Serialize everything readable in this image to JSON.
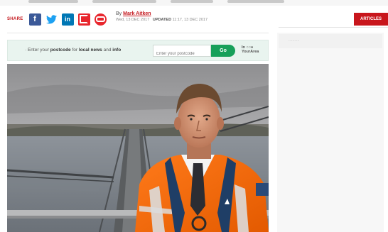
{
  "share": {
    "label": "SHARE",
    "buttons": [
      {
        "network": "facebook",
        "glyph": "f",
        "color": "#3b5998"
      },
      {
        "network": "twitter",
        "glyph": "t",
        "color": "#1da1f2"
      },
      {
        "network": "linkedin",
        "glyph": "in",
        "color": "#0077b5"
      },
      {
        "network": "flipboard",
        "glyph": "",
        "color": "#e8262d"
      },
      {
        "network": "email",
        "glyph": "",
        "color": "#e8262d"
      }
    ]
  },
  "article_meta": {
    "by_prefix": "By",
    "author": "Mark Aitken",
    "published": "Wed, 13 DEC 2017",
    "updated_label": "UPDATED",
    "updated": "11:17, 13 DEC 2017"
  },
  "header": {
    "red_tab_label": "ARTICLES"
  },
  "postcode_widget": {
    "prompt_prefix": "· Enter your",
    "prompt_bold1": "postcode",
    "prompt_middle": "for",
    "prompt_bold2": "local news",
    "prompt_and": "and",
    "prompt_bold3": "info",
    "input_placeholder": "Enter your postcode",
    "go_label": "Go",
    "brand_line1": "In ○○●",
    "brand_line2": "YourArea"
  },
  "sidebar": {
    "top_label": "..........."
  },
  "colors": {
    "brand_red": "#c4161c",
    "go_green": "#17a05a",
    "widget_bg": "#e9f4ef"
  }
}
